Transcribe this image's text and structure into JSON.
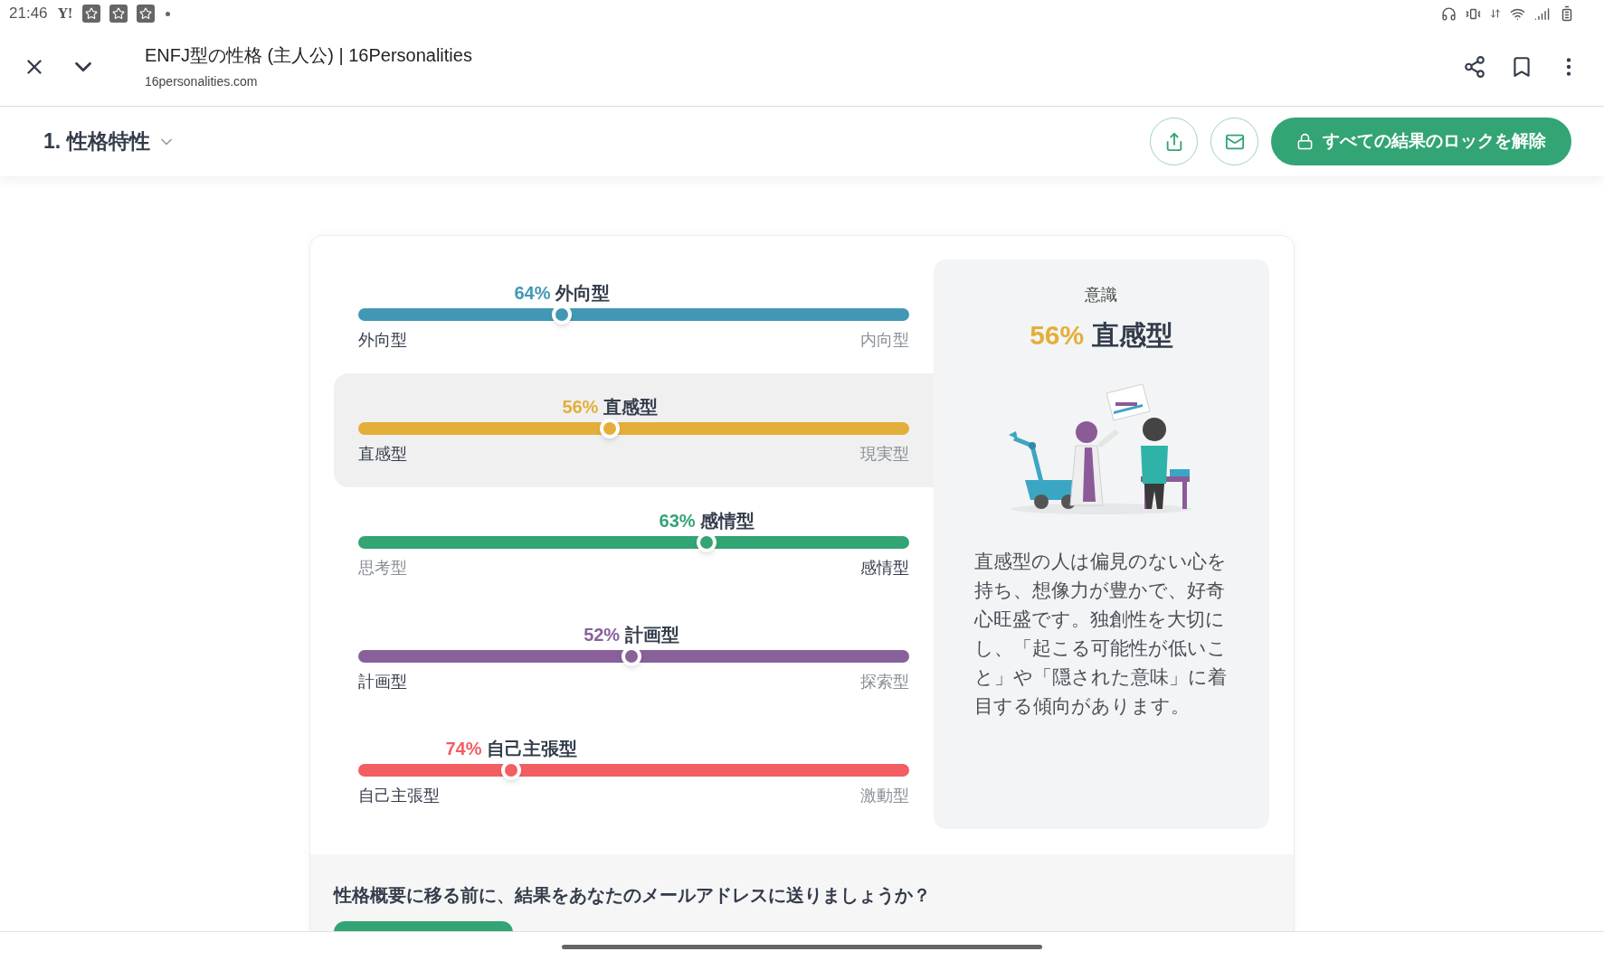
{
  "status_bar": {
    "time": "21:46",
    "notification_text": "Y!"
  },
  "browser": {
    "title": "ENFJ型の性格 (主人公) | 16Personalities",
    "url": "16personalities.com"
  },
  "section_bar": {
    "title": "1. 性格特性",
    "unlock_button": "すべての結果のロックを解除"
  },
  "traits": [
    {
      "percent": "64%",
      "name": "外向型",
      "left": "外向型",
      "right": "内向型",
      "left_dominant": true,
      "color": "#4298b4",
      "level": 0.37,
      "selected": false
    },
    {
      "percent": "56%",
      "name": "直感型",
      "left": "直感型",
      "right": "現実型",
      "left_dominant": true,
      "color": "#e4ae3a",
      "level": 0.457,
      "selected": true
    },
    {
      "percent": "63%",
      "name": "感情型",
      "left": "思考型",
      "right": "感情型",
      "left_dominant": false,
      "color": "#33a474",
      "level": 0.633,
      "selected": false
    },
    {
      "percent": "52%",
      "name": "計画型",
      "left": "計画型",
      "right": "探索型",
      "left_dominant": true,
      "color": "#88619a",
      "level": 0.496,
      "selected": false
    },
    {
      "percent": "74%",
      "name": "自己主張型",
      "left": "自己主張型",
      "right": "激動型",
      "left_dominant": true,
      "color": "#f25e62",
      "level": 0.278,
      "selected": false
    }
  ],
  "detail": {
    "category": "意識",
    "percent": "56%",
    "name": "直感型",
    "description": "直感型の人は偏見のない心を持ち、想像力が豊かで、好奇心旺盛です。独創性を大切にし、「起こる可能性が低いこと」や「隠された意味」に着目する傾向があります。"
  },
  "email_prompt": {
    "text": "性格概要に移る前に、結果をあなたのメールアドレスに送りましょうか？"
  }
}
